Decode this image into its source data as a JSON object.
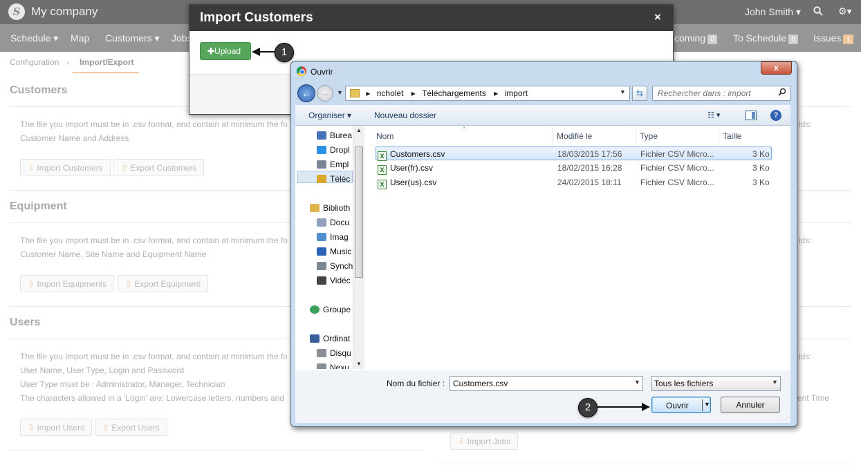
{
  "app": {
    "brand": "My company",
    "user": "John Smith ▾",
    "search_icon": "search-icon",
    "gear_icon": "gear-icon"
  },
  "menu": [
    {
      "label": "Schedule ▾"
    },
    {
      "label": "Map"
    },
    {
      "label": "Customers ▾"
    },
    {
      "label": "Jobs"
    }
  ],
  "menu_right": [
    {
      "label": "coming",
      "badge": "0"
    },
    {
      "label": "To Schedule",
      "badge": "6"
    },
    {
      "label": "Issues",
      "badge": "1"
    }
  ],
  "breadcrumb": {
    "item1": "Configuration",
    "sep": "›",
    "item2": "Import/Export"
  },
  "sections": {
    "customers": {
      "title": "Customers",
      "line1": "The file you import must be in .csv format, and contain at minimum the fo",
      "line2": "Customer Name and Address",
      "import": "Import Customers",
      "export": "Export Customers"
    },
    "equipment": {
      "title": "Equipment",
      "line1": "The file you import must be in .csv format, and contain at minimum the fo",
      "line2": "Customer Name, Site Name and Equipment Name",
      "import": "Import Equipments",
      "export": "Export Equipment"
    },
    "users": {
      "title": "Users",
      "line1": "The file you import must be in .csv format, and contain at minimum the fo",
      "line2": "User Name, User Type, Login and Password",
      "line3": "User Type must be : Administrator, Manager, Technician",
      "line4": "The characters allowed in a 'Login' are: Lowercase letters, numbers and",
      "import": "Import Users",
      "export": "Export Users"
    },
    "right": {
      "ids1": "ids:",
      "ids2": "ids:",
      "ids3": "ids:",
      "tail": "ent Time",
      "import_jobs": "Import Jobs"
    }
  },
  "modal": {
    "title": "Import Customers",
    "close": "×",
    "upload": "Upload"
  },
  "callouts": [
    "1",
    "2"
  ],
  "dialog": {
    "title": "Ouvrir",
    "close": "x",
    "path": [
      "ncholet",
      "Téléchargements",
      "import"
    ],
    "search_placeholder": "Rechercher dans : import",
    "toolbar": {
      "organize": "Organiser ▾",
      "new_folder": "Nouveau dossier"
    },
    "nav": [
      {
        "label": "Burea",
        "color": "#4a72b8"
      },
      {
        "label": "Dropl",
        "color": "#2b8fe3"
      },
      {
        "label": "Empl",
        "color": "#7a8694"
      },
      {
        "label": "Téléc",
        "color": "#d9a62b"
      },
      {
        "label": "Biblioth",
        "color": "#e0b64a"
      },
      {
        "label": "Docu",
        "color": "#8fa1b8"
      },
      {
        "label": "Imag",
        "color": "#4f8fd0"
      },
      {
        "label": "Music",
        "color": "#2c63b6"
      },
      {
        "label": "Synch",
        "color": "#7a8694"
      },
      {
        "label": "Vidéc",
        "color": "#444"
      },
      {
        "label": "Groupe",
        "color": "#3aa05a"
      },
      {
        "label": "Ordinat",
        "color": "#3a5f9a"
      },
      {
        "label": "Disqu",
        "color": "#8a8f96"
      },
      {
        "label": "Nexu",
        "color": "#8a8f96"
      }
    ],
    "columns": {
      "name": "Nom",
      "modified": "Modifié le",
      "type": "Type",
      "size": "Taille"
    },
    "files": [
      {
        "name": "Customers.csv",
        "modified": "18/03/2015 17:56",
        "type": "Fichier CSV Micro...",
        "size": "3 Ko"
      },
      {
        "name": "User(fr).csv",
        "modified": "18/02/2015 16:28",
        "type": "Fichier CSV Micro...",
        "size": "3 Ko"
      },
      {
        "name": "User(us).csv",
        "modified": "24/02/2015 18:11",
        "type": "Fichier CSV Micro...",
        "size": "3 Ko"
      }
    ],
    "filename_label": "Nom du fichier :",
    "filename_value": "Customers.csv",
    "filetype": "Tous les fichiers",
    "open": "Ouvrir",
    "cancel": "Annuler"
  }
}
